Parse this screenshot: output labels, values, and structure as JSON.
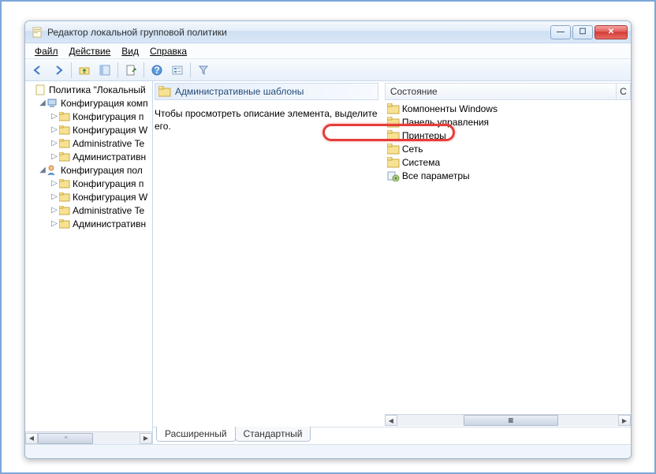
{
  "window": {
    "title": "Редактор локальной групповой политики"
  },
  "titlebar_buttons": {
    "min": "—",
    "max": "☐",
    "close": "✕"
  },
  "menu": {
    "file": "Файл",
    "action": "Действие",
    "view": "Вид",
    "help": "Справка"
  },
  "toolbar_icons": {
    "back": "back-arrow",
    "forward": "forward-arrow",
    "up": "folder-up",
    "show_tree": "show-tree",
    "export": "export-list",
    "help": "help",
    "properties": "properties",
    "filter": "filter"
  },
  "tree": {
    "root": "Политика \"Локальный",
    "computer_config": "Конфигурация комп",
    "computer_children": [
      "Конфигурация п",
      "Конфигурация W",
      "Administrative Te",
      "Административн"
    ],
    "user_config": "Конфигурация пол",
    "user_children": [
      "Конфигурация п",
      "Конфигурация W",
      "Administrative Te",
      "Административн"
    ]
  },
  "content": {
    "heading": "Административные шаблоны",
    "hint": "Чтобы просмотреть описание элемента, выделите его.",
    "column_state": "Состояние",
    "column_extra": "C",
    "items": [
      {
        "label": "Компоненты Windows",
        "highlight": true
      },
      {
        "label": "Панель управления"
      },
      {
        "label": "Принтеры"
      },
      {
        "label": "Сеть"
      },
      {
        "label": "Система"
      },
      {
        "label": "Все параметры",
        "special_icon": true
      }
    ]
  },
  "tabs": {
    "extended": "Расширенный",
    "standard": "Стандартный"
  }
}
